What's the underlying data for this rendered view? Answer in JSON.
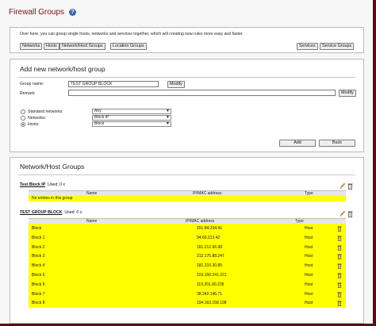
{
  "page": {
    "title": "Firewall Groups",
    "help_icon": "?"
  },
  "intro": {
    "text": "Over here, you can group single hosts, networks and services together, which will creating new rules more easy and faster.",
    "left_buttons": [
      "Networks",
      "Hosts",
      "Network/Host Groups",
      "Location Groups"
    ],
    "right_buttons": [
      "Services",
      "Service Groups"
    ]
  },
  "add_form": {
    "title": "Add new network/host group",
    "group_name_label": "Group name:",
    "group_name_value": "TEST GROUP BLOCK",
    "modify_label_1": "Modify",
    "remark_label": "Remark:",
    "remark_value": "",
    "modify_label_2": "Modify",
    "options": [
      {
        "label": "Standard networks:",
        "value": "Any",
        "checked": false
      },
      {
        "label": "Networks:",
        "value": "Block IP",
        "checked": false
      },
      {
        "label": "Hosts:",
        "value": "Block",
        "checked": true
      }
    ],
    "add_label": "Add",
    "back_label": "Back"
  },
  "groups_section": {
    "title": "Network/Host Groups",
    "columns": [
      "Name",
      "IP/MAC address",
      "Type"
    ],
    "groups": [
      {
        "name": "Test Block IP",
        "used": "Used: 0 x",
        "empty_text": "No entries in this group",
        "rows": []
      },
      {
        "name": "TEST GROUP BLOCK",
        "used": "Used: 0 x",
        "rows": [
          {
            "name": "Block",
            "address": "151.84.234.41",
            "type": "Host"
          },
          {
            "name": "Block 1",
            "address": "94.60.213.42",
            "type": "Host"
          },
          {
            "name": "Block 2",
            "address": "181.212.66.98",
            "type": "Host"
          },
          {
            "name": "Block 3",
            "address": "212.175.88.247",
            "type": "Host"
          },
          {
            "name": "Block 4",
            "address": "181.210.30.85",
            "type": "Host"
          },
          {
            "name": "Block 5",
            "address": "103.150.241.221",
            "type": "Host"
          },
          {
            "name": "Block 6",
            "address": "119.201.60.235",
            "type": "Host"
          },
          {
            "name": "Block 7",
            "address": "38.242.146.71",
            "type": "Host"
          },
          {
            "name": "Block 8",
            "address": "194.163.158.198",
            "type": "Host"
          }
        ]
      }
    ]
  },
  "colors": {
    "title": "#7a1212",
    "row_highlight": "#ffff00",
    "frame": "#5a0e0e",
    "edit_icon": "#e0a020"
  },
  "icons": {
    "edit": "pencil-icon",
    "delete": "trash-icon",
    "help": "help-icon"
  }
}
